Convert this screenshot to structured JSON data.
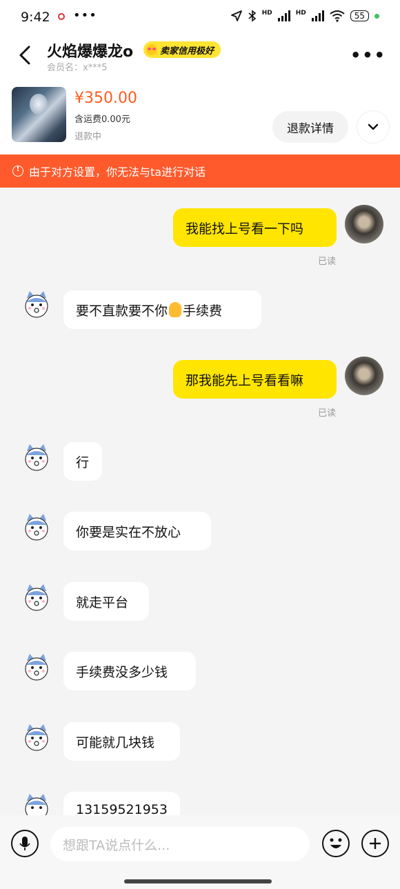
{
  "status_bar": {
    "time": "9:42",
    "more": "•••",
    "hd1": "HD",
    "hd2": "HD",
    "battery": "55"
  },
  "header": {
    "seller_name": "火焰爆爆龙o",
    "credit_badge": "卖家信用极好",
    "member_label": "会员名：x***5",
    "more": "•••"
  },
  "product": {
    "price": "¥350.00",
    "shipping": "含运费0.00元",
    "status": "退款中",
    "refund_button": "退款详情"
  },
  "warning": {
    "text": "由于对方设置，你无法与ta进行对话"
  },
  "messages": [
    {
      "from": "me",
      "text": "我能找上号看一下吗",
      "read": "已读"
    },
    {
      "from": "them",
      "text_before": "要不直款要不你",
      "text_after": "手续费"
    },
    {
      "from": "me",
      "text": "那我能先上号看看嘛",
      "read": "已读"
    },
    {
      "from": "them",
      "text": "行"
    },
    {
      "from": "them",
      "text": "你要是实在不放心"
    },
    {
      "from": "them",
      "text": "就走平台"
    },
    {
      "from": "them",
      "text": "手续费没多少钱"
    },
    {
      "from": "them",
      "text": "可能就几块钱"
    },
    {
      "from": "them",
      "text": "13159521953"
    }
  ],
  "input": {
    "placeholder": "想跟TA说点什么..."
  },
  "colors": {
    "accent_yellow": "#ffe500",
    "warning_orange": "#ff5a2c",
    "price_orange": "#ff5a1f"
  }
}
